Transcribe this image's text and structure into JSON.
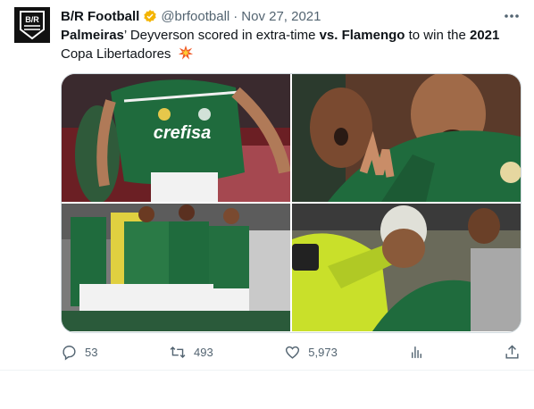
{
  "account": {
    "avatar_text": "B/R",
    "name": "B/R Football",
    "handle": "@brfootball",
    "separator": "·",
    "date": "Nov 27, 2021",
    "verified_icon": "verified-badge-icon"
  },
  "tweet": {
    "team1": "Palmeiras",
    "part1": "’ Deyverson scored in extra-time ",
    "vs": "vs. Flamengo",
    "part2": " to win the ",
    "year": "2021",
    "line2": "Copa Libertadores",
    "emoji": "collision-emoji-icon"
  },
  "media": {
    "photos": [
      {
        "name": "player-jersey-crefisa"
      },
      {
        "name": "player-celebrating-closeup"
      },
      {
        "name": "team-celebration-group"
      },
      {
        "name": "player-crying-hug"
      }
    ],
    "jersey_sponsor": "crefisa"
  },
  "actions": {
    "reply_count": "53",
    "retweet_count": "493",
    "like_count": "5,973",
    "views_label": "",
    "icons": [
      "reply-icon",
      "retweet-icon",
      "like-icon",
      "views-icon",
      "share-icon"
    ]
  },
  "colors": {
    "text": "#0f1419",
    "secondary": "#536471",
    "verified": "#f4b400",
    "jersey_green": "#1f6b3d"
  }
}
